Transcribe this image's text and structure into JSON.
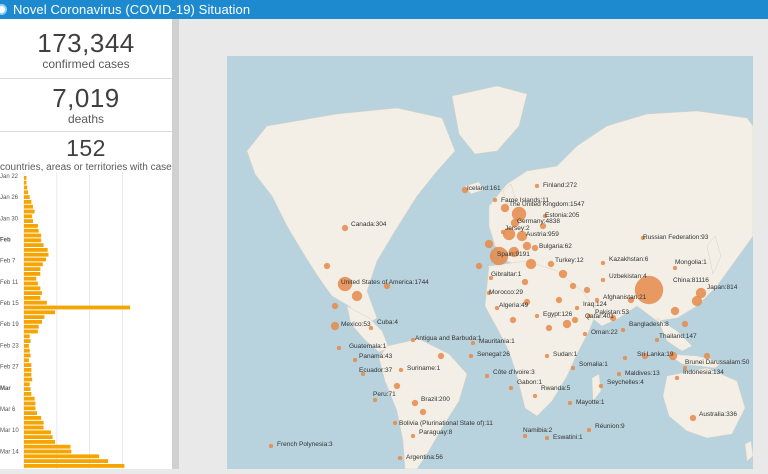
{
  "header": {
    "title": "Novel Coronavirus (COVID-19) Situation"
  },
  "stats": [
    {
      "value": "173,344",
      "label": "confirmed cases"
    },
    {
      "value": "7,019",
      "label": "deaths"
    },
    {
      "value": "152",
      "label": "countries, areas or territories with cases"
    }
  ],
  "chart_data": {
    "type": "bar",
    "orientation": "horizontal",
    "date_ticks": [
      "Jan 22",
      "Jan 26",
      "Jan 30",
      "Feb",
      "Feb 7",
      "Feb 11",
      "Feb 15",
      "Feb 19",
      "Feb 23",
      "Feb 27",
      "Mar",
      "Mar 6",
      "Mar 10",
      "Mar 14"
    ],
    "values": [
      3,
      3,
      4,
      5,
      7,
      9,
      11,
      13,
      10,
      11,
      17,
      18,
      21,
      21,
      24,
      29,
      30,
      27,
      23,
      20,
      20,
      15,
      17,
      20,
      22,
      20,
      28,
      130,
      38,
      25,
      22,
      18,
      17,
      7,
      8,
      6,
      7,
      8,
      6,
      9,
      9,
      9,
      10,
      7,
      8,
      9,
      13,
      14,
      14,
      16,
      21,
      24,
      24,
      33,
      35,
      38,
      57,
      58,
      92,
      103,
      123
    ],
    "grid": true,
    "colors": {
      "bar": "#f5a400"
    }
  },
  "map": {
    "labels": [
      {
        "text": "Iceland:161"
      },
      {
        "text": "Finland:272"
      },
      {
        "text": "Faroe Islands:11"
      },
      {
        "text": "Estonia:205"
      },
      {
        "text": "Russian Federation:93"
      },
      {
        "text": "Canada:304"
      },
      {
        "text": "The United Kingdom:1547"
      },
      {
        "text": "Germany:4838"
      },
      {
        "text": "Jersey:2"
      },
      {
        "text": "Austria:959"
      },
      {
        "text": "Kazakhstan:6"
      },
      {
        "text": "Mongolia:1"
      },
      {
        "text": "Uzbekistan:4"
      },
      {
        "text": "China:81116"
      },
      {
        "text": "Spain:9191"
      },
      {
        "text": "Bulgaria:62"
      },
      {
        "text": "United States of America:1744"
      },
      {
        "text": "Turkey:12"
      },
      {
        "text": "Japan:814"
      },
      {
        "text": "Gibraltar:1"
      },
      {
        "text": "Afghanistan:21"
      },
      {
        "text": "Morocco:29"
      },
      {
        "text": "Iraq:124"
      },
      {
        "text": "Pakistan:53"
      },
      {
        "text": "Algeria:49"
      },
      {
        "text": "Egypt:126"
      },
      {
        "text": "Qatar:401"
      },
      {
        "text": "Mexico:53"
      },
      {
        "text": "Bangladesh:8"
      },
      {
        "text": "Cuba:4"
      },
      {
        "text": "Mauritania:1"
      },
      {
        "text": "Oman:22"
      },
      {
        "text": "Antigua and Barbuda:1"
      },
      {
        "text": "Senegal:26"
      },
      {
        "text": "Sudan:1"
      },
      {
        "text": "Thailand:147"
      },
      {
        "text": "Guatemala:1"
      },
      {
        "text": "Panama:43"
      },
      {
        "text": "Sri Lanka:19"
      },
      {
        "text": "Somalia:1"
      },
      {
        "text": "Suriname:1"
      },
      {
        "text": "Côte d'Ivoire:3"
      },
      {
        "text": "Brunei Darussalam:50"
      },
      {
        "text": "Maldives:13"
      },
      {
        "text": "Ecuador:37"
      },
      {
        "text": "Gabon:1"
      },
      {
        "text": "Rwanda:5"
      },
      {
        "text": "Indonesia:134"
      },
      {
        "text": "Seychelles:4"
      },
      {
        "text": "Peru:71"
      },
      {
        "text": "Brazil:200"
      },
      {
        "text": "Mayotte:1"
      },
      {
        "text": "Bolivia (Plurinational State of):11"
      },
      {
        "text": "French Polynesia:3"
      },
      {
        "text": "Namibia:2"
      },
      {
        "text": "Paraguay:8"
      },
      {
        "text": "Réunion:9"
      },
      {
        "text": "Eswatini:1"
      },
      {
        "text": "Australia:336"
      },
      {
        "text": "Argentina:56"
      },
      {
        "text": "w Zealand:6"
      }
    ],
    "colors": {
      "ocean": "#b8d3de",
      "land": "#f3efe6",
      "bubble": "#e58a4a"
    }
  }
}
